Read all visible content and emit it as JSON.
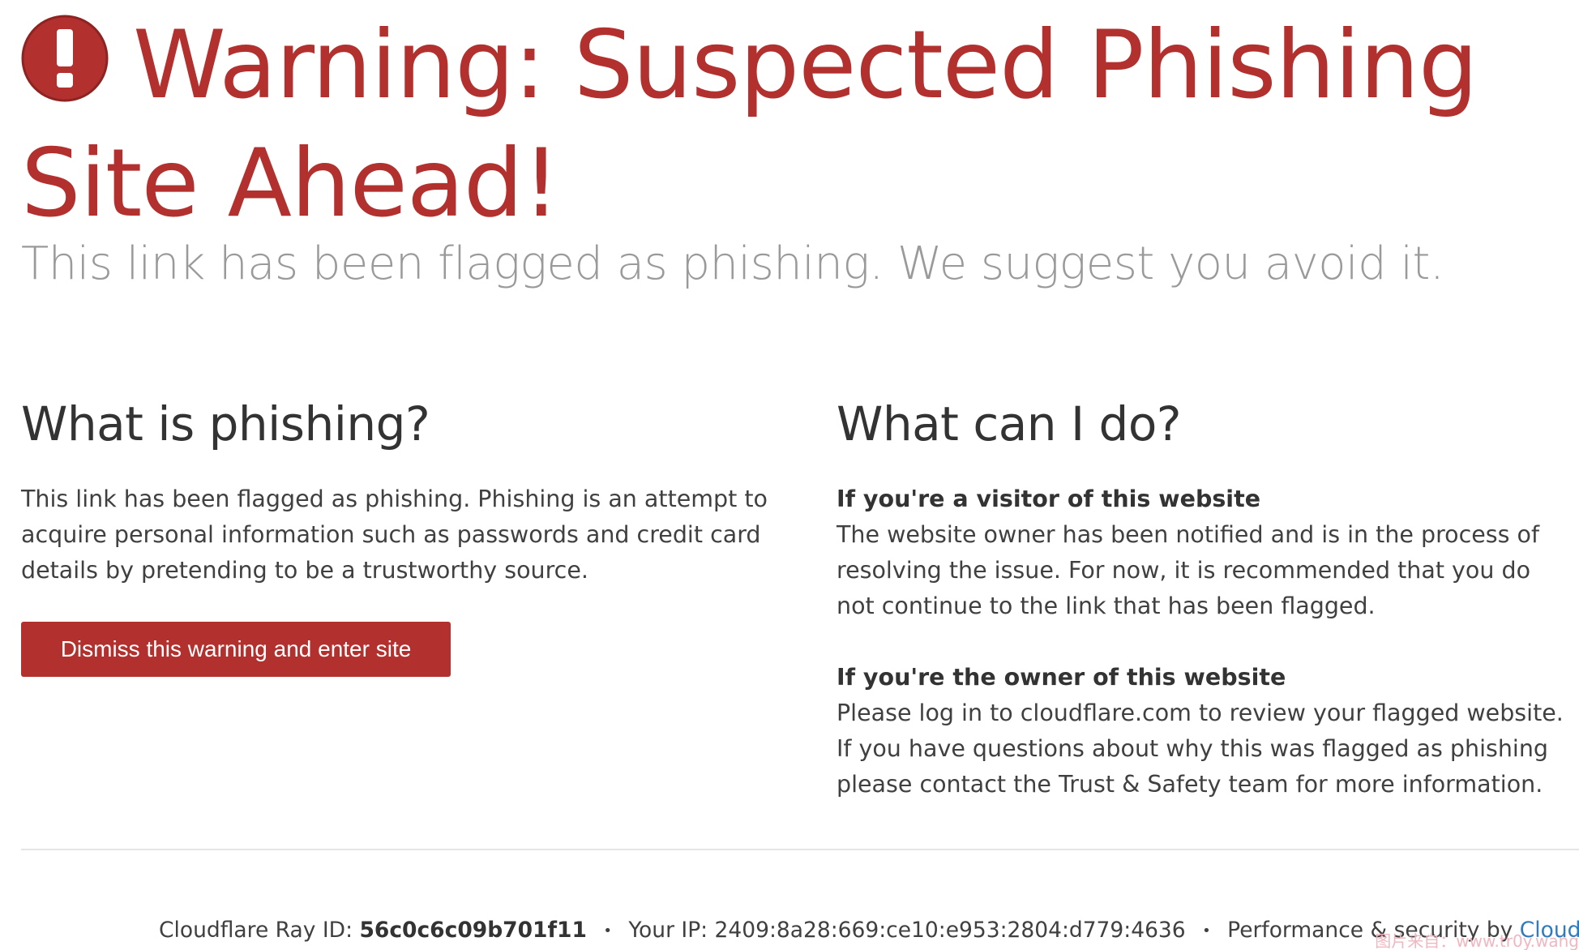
{
  "hero": {
    "title": "Warning: Suspected Phishing Site Ahead!",
    "subtitle": "This link has been flagged as phishing. We suggest you avoid it.",
    "icon": "exclamation-circle-icon",
    "accent_color": "#b2302e"
  },
  "left": {
    "heading": "What is phishing?",
    "body": "This link has been flagged as phishing. Phishing is an attempt to acquire personal information such as passwords and credit card details by pretending to be a trustworthy source.",
    "button_label": "Dismiss this warning and enter site"
  },
  "right": {
    "heading": "What can I do?",
    "visitor_title": "If you're a visitor of this website",
    "visitor_body": "The website owner has been notified and is in the process of resolving the issue. For now, it is recommended that you do not continue to the link that has been flagged.",
    "owner_title": "If you're the owner of this website",
    "owner_body": "Please log in to cloudflare.com to review your flagged website. If you have questions about why this was flagged as phishing please contact the Trust & Safety team for more information."
  },
  "footer": {
    "ray_label": "Cloudflare Ray ID:",
    "ray_id": "56c0c6c09b701f11",
    "separator": "•",
    "ip_label": "Your IP:",
    "ip": "2409:8a28:669:ce10:e953:2804:d779:4636",
    "perf_label": "Performance & security by",
    "brand_link": "Cloudflare",
    "link_color": "#2f7bbf"
  },
  "watermark": "图片来自：www.tr0y.wang"
}
